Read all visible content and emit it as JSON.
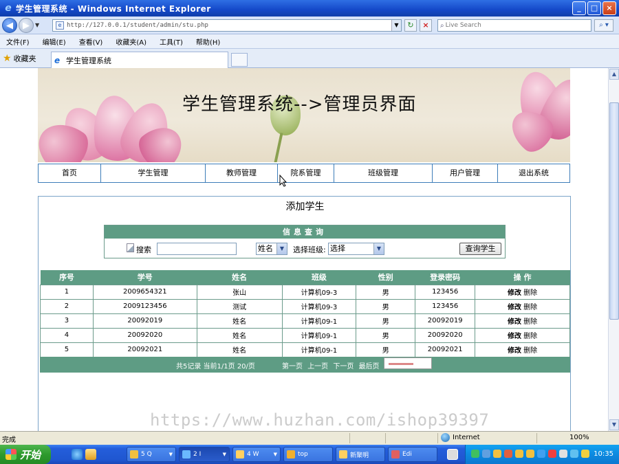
{
  "window": {
    "title": "学生管理系统 - Windows Internet Explorer",
    "minimize": "_",
    "maximize": "□",
    "close": "×"
  },
  "address": {
    "url": "http://127.0.0.1/student/admin/stu.php",
    "search_placeholder": "Live Search"
  },
  "menu": [
    "文件(F)",
    "编辑(E)",
    "查看(V)",
    "收藏夹(A)",
    "工具(T)",
    "帮助(H)"
  ],
  "favorites": {
    "label": "收藏夹",
    "tab_title": "学生管理系统"
  },
  "banner": {
    "title": "学生管理系统-->管理员界面"
  },
  "nav": [
    "首页",
    "学生管理",
    "教师管理",
    "院系管理",
    "班级管理",
    "用户管理",
    "退出系统"
  ],
  "page": {
    "title": "添加学生"
  },
  "search": {
    "header": "信息查询",
    "label": "搜索",
    "input_value": "",
    "field_selected": "姓名",
    "class_label": "选择班级:",
    "class_selected": "选择",
    "button": "查询学生"
  },
  "table": {
    "columns": [
      "序号",
      "学号",
      "姓名",
      "班级",
      "性别",
      "登录密码",
      "操 作"
    ],
    "edit_label": "修改",
    "delete_label": "删除",
    "rows": [
      {
        "no": "1",
        "id": "2009654321",
        "name": "张山",
        "class": "计算机09-3",
        "gender": "男",
        "password": "123456"
      },
      {
        "no": "2",
        "id": "2009123456",
        "name": "测试",
        "class": "计算机09-3",
        "gender": "男",
        "password": "123456"
      },
      {
        "no": "3",
        "id": "20092019",
        "name": "姓名",
        "class": "计算机09-1",
        "gender": "男",
        "password": "20092019"
      },
      {
        "no": "4",
        "id": "20092020",
        "name": "姓名",
        "class": "计算机09-1",
        "gender": "男",
        "password": "20092020"
      },
      {
        "no": "5",
        "id": "20092021",
        "name": "姓名",
        "class": "计算机09-1",
        "gender": "男",
        "password": "20092021"
      }
    ],
    "footer": {
      "stats": "共5记录  当前1/1页  20/页",
      "first": "第一页",
      "prev": "上一页",
      "next": "下一页",
      "last": "最后页"
    }
  },
  "watermark": "https://www.huzhan.com/ishop39397",
  "status": {
    "text": "完成",
    "zone": "Internet",
    "zoom": "100%"
  },
  "taskbar": {
    "start": "开始",
    "tasks": [
      "5 Q",
      "2 I",
      "4 W",
      "top",
      "新聚明",
      "Edi"
    ],
    "clock": "10:35"
  },
  "colors": {
    "table_header": "#5e9c84",
    "nav_border": "#3c7cb8",
    "title_bar": "#1448c8"
  }
}
